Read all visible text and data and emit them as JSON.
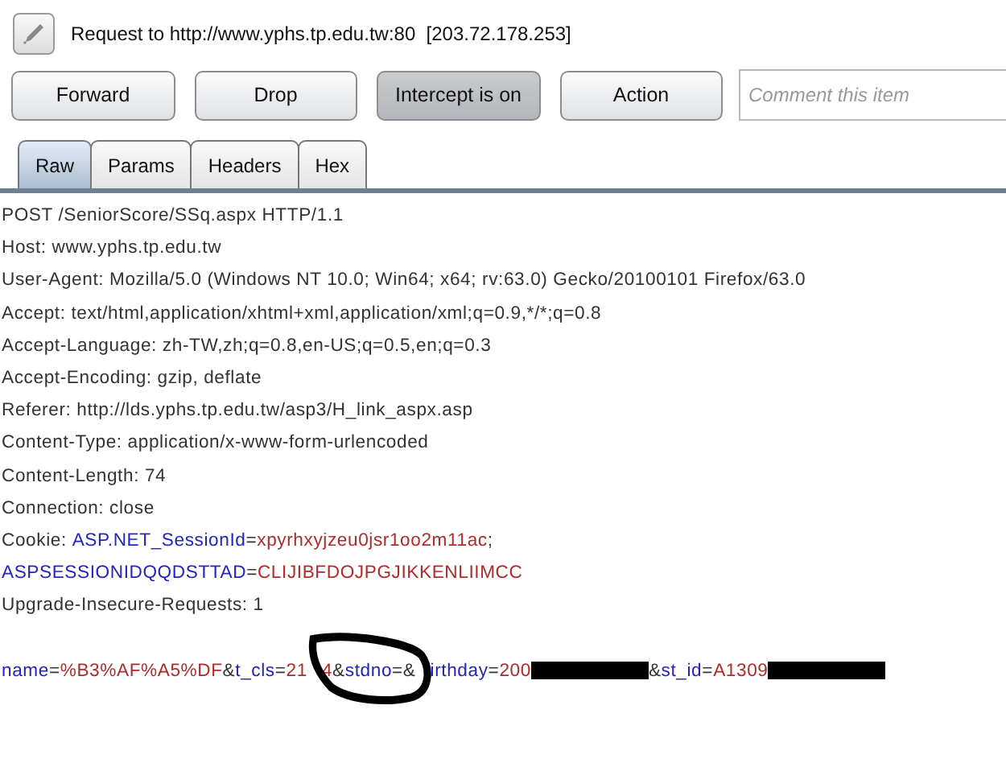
{
  "title": "Request to http://www.yphs.tp.edu.tw:80  [203.72.178.253]",
  "buttons": [
    {
      "label": "Forward",
      "selected": false
    },
    {
      "label": "Drop",
      "selected": false
    },
    {
      "label": "Intercept is on",
      "selected": true
    },
    {
      "label": "Action",
      "selected": false
    }
  ],
  "comment": {
    "placeholder": "Comment this item"
  },
  "tabs": [
    {
      "label": "Raw",
      "selected": true
    },
    {
      "label": "Params",
      "selected": false
    },
    {
      "label": "Headers",
      "selected": false
    },
    {
      "label": "Hex",
      "selected": false
    }
  ],
  "headers": [
    [
      {
        "kind": "plain",
        "text": "POST /SeniorScore/SSq.aspx HTTP/1.1"
      }
    ],
    [
      {
        "kind": "plain",
        "text": "Host: www.yphs.tp.edu.tw"
      }
    ],
    [
      {
        "kind": "plain",
        "text": "User-Agent: Mozilla/5.0 (Windows NT 10.0; Win64; x64; rv:63.0) Gecko/20100101 Firefox/63.0"
      }
    ],
    [
      {
        "kind": "plain",
        "text": "Accept: text/html,application/xhtml+xml,application/xml;q=0.9,*/*;q=0.8"
      }
    ],
    [
      {
        "kind": "plain",
        "text": "Accept-Language: zh-TW,zh;q=0.8,en-US;q=0.5,en;q=0.3"
      }
    ],
    [
      {
        "kind": "plain",
        "text": "Accept-Encoding: gzip, deflate"
      }
    ],
    [
      {
        "kind": "plain",
        "text": "Referer: http://lds.yphs.tp.edu.tw/asp3/H_link_aspx.asp"
      }
    ],
    [
      {
        "kind": "plain",
        "text": "Content-Type: application/x-www-form-urlencoded"
      }
    ],
    [
      {
        "kind": "plain",
        "text": "Content-Length: 74"
      }
    ],
    [
      {
        "kind": "plain",
        "text": "Connection: close"
      }
    ],
    [
      {
        "kind": "plain",
        "text": "Cookie: "
      },
      {
        "kind": "param",
        "text": "ASP.NET_SessionId"
      },
      {
        "kind": "plain",
        "text": "="
      },
      {
        "kind": "value",
        "text": "xpyrhxyjzeu0jsr1oo2m11ac"
      },
      {
        "kind": "plain",
        "text": ";"
      }
    ],
    [
      {
        "kind": "param",
        "text": "ASPSESSIONIDQQDSTTAD"
      },
      {
        "kind": "plain",
        "text": "="
      },
      {
        "kind": "value",
        "text": "CLIJIBFDOJPGJIKKENLIIMCC"
      }
    ],
    [
      {
        "kind": "plain",
        "text": "Upgrade-Insecure-Requests: 1"
      }
    ]
  ],
  "body": [
    {
      "kind": "param",
      "text": "name"
    },
    {
      "kind": "plain",
      "text": "="
    },
    {
      "kind": "value",
      "text": "%B3%AF%A5%DF"
    },
    {
      "kind": "plain",
      "text": "&"
    },
    {
      "kind": "param",
      "text": "t_cls"
    },
    {
      "kind": "plain",
      "text": "="
    },
    {
      "kind": "value",
      "text": "21"
    },
    {
      "kind": "circled",
      "parts": [
        {
          "kind": "value",
          "text": "4"
        },
        {
          "kind": "plain",
          "text": "&"
        },
        {
          "kind": "param",
          "text": "stdno"
        },
        {
          "kind": "plain",
          "text": "=&"
        }
      ]
    },
    {
      "kind": "param",
      "text": "irthday"
    },
    {
      "kind": "plain",
      "text": "="
    },
    {
      "kind": "value",
      "text": "200"
    },
    {
      "kind": "redaction"
    },
    {
      "kind": "plain",
      "text": "&"
    },
    {
      "kind": "param",
      "text": "st_id"
    },
    {
      "kind": "plain",
      "text": "="
    },
    {
      "kind": "value",
      "text": "A1309"
    },
    {
      "kind": "redaction"
    }
  ]
}
